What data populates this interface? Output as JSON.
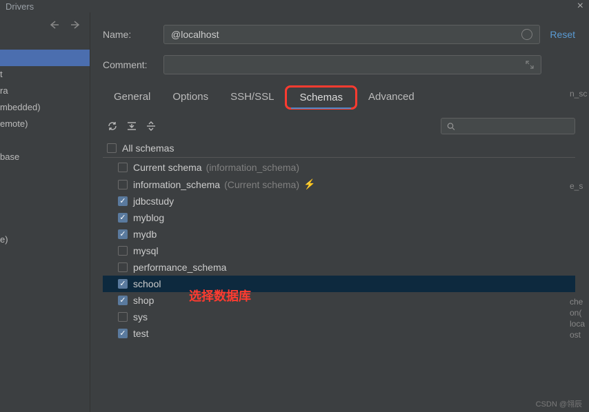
{
  "window": {
    "title": "Drivers",
    "close": "×"
  },
  "sidebar": {
    "items": [
      "",
      "t",
      "ra",
      "mbedded)",
      "emote)",
      "",
      "base",
      "",
      "",
      "",
      "",
      "e)"
    ]
  },
  "form": {
    "name_label": "Name:",
    "name_value": "@localhost",
    "comment_label": "Comment:",
    "reset": "Reset"
  },
  "tabs": [
    "General",
    "Options",
    "SSH/SSL",
    "Schemas",
    "Advanced"
  ],
  "schema_toolbar": {
    "search_placeholder": ""
  },
  "schemas": {
    "all_label": "All schemas",
    "items": [
      {
        "label": "Current schema",
        "extra": "(information_schema)",
        "checked": false,
        "selected": false,
        "bolt": false
      },
      {
        "label": "information_schema",
        "extra": "(Current schema)",
        "checked": false,
        "selected": false,
        "bolt": true
      },
      {
        "label": "jdbcstudy",
        "extra": "",
        "checked": true,
        "selected": false,
        "bolt": false
      },
      {
        "label": "myblog",
        "extra": "",
        "checked": true,
        "selected": false,
        "bolt": false
      },
      {
        "label": "mydb",
        "extra": "",
        "checked": true,
        "selected": false,
        "bolt": false
      },
      {
        "label": "mysql",
        "extra": "",
        "checked": false,
        "selected": false,
        "bolt": false
      },
      {
        "label": "performance_schema",
        "extra": "",
        "checked": false,
        "selected": false,
        "bolt": false
      },
      {
        "label": "school",
        "extra": "",
        "checked": true,
        "selected": true,
        "bolt": false
      },
      {
        "label": "shop",
        "extra": "",
        "checked": true,
        "selected": false,
        "bolt": false
      },
      {
        "label": "sys",
        "extra": "",
        "checked": false,
        "selected": false,
        "bolt": false
      },
      {
        "label": "test",
        "extra": "",
        "checked": true,
        "selected": false,
        "bolt": false
      }
    ]
  },
  "annotation": "选择数据库",
  "rightstrip": [
    "n_sc",
    "",
    "",
    "",
    "",
    "e_s",
    "",
    "",
    "",
    "",
    "",
    "",
    "che",
    "on(",
    "loca",
    "ost"
  ],
  "watermark": "CSDN @翎辰"
}
